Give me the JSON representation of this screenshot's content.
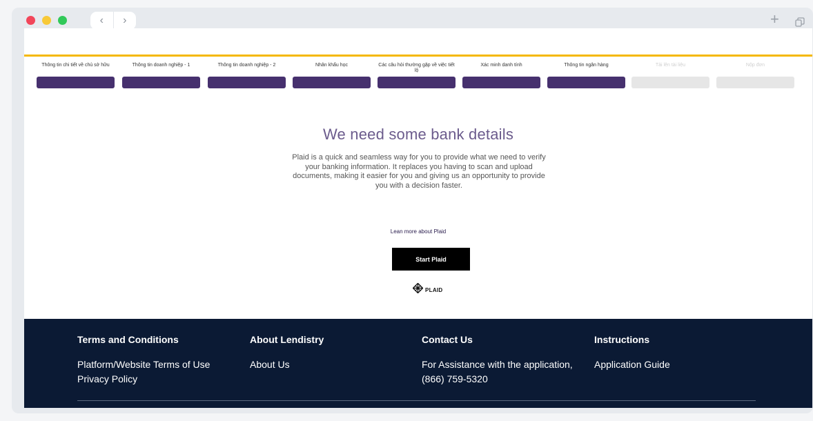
{
  "browser": {
    "back_icon": "chevron-left-icon",
    "forward_icon": "chevron-right-icon",
    "new_tab_icon": "plus-icon",
    "tabs_icon": "copy-icon"
  },
  "steps": [
    {
      "label": "Thông tin chi tiết về chủ sở hữu",
      "state": "done"
    },
    {
      "label": "Thông tin doanh nghiệp - 1",
      "state": "done"
    },
    {
      "label": "Thông tin doanh nghiệp - 2",
      "state": "done"
    },
    {
      "label": "Nhân khẩu học",
      "state": "done"
    },
    {
      "label": "Các câu hỏi thường gặp về việc tiết lộ",
      "state": "done"
    },
    {
      "label": "Xác minh danh tính",
      "state": "done"
    },
    {
      "label": "Thông tin ngân hàng",
      "state": "current"
    },
    {
      "label": "Tải lên tài liệu",
      "state": "future"
    },
    {
      "label": "Nộp đơn",
      "state": "future"
    }
  ],
  "main": {
    "headline": "We need some bank details",
    "description": "Plaid is a quick and seamless way for you to provide what we need to verify your banking information. It replaces you having to scan and upload documents, making it easier for you and giving us an opportunity to provide you with a decision faster.",
    "learn_more": "Lean more about Plaid",
    "start_button": "Start Plaid",
    "logo_text": "PLAID"
  },
  "footer": {
    "terms": {
      "heading": "Terms and Conditions",
      "links": [
        "Platform/Website Terms of Use",
        "Privacy Policy"
      ]
    },
    "about": {
      "heading": "About Lendistry",
      "links": [
        "About Us"
      ]
    },
    "contact": {
      "heading": "Contact Us",
      "links": [
        "For Assistance with the application,",
        "(866) 759-5320"
      ]
    },
    "instructions": {
      "heading": "Instructions",
      "links": [
        "Application Guide"
      ]
    }
  },
  "colors": {
    "accent_gold": "#f5b800",
    "step_done": "#46306e",
    "step_future": "#e6e6e6",
    "footer_bg": "#0b1a34"
  }
}
